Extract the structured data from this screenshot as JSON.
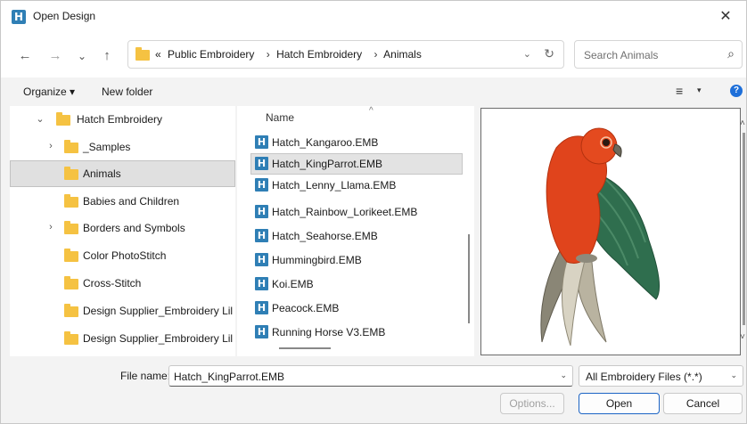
{
  "window": {
    "title": "Open Design",
    "close_symbol": "✕",
    "logo_letter": "H"
  },
  "nav": {
    "back": "←",
    "forward": "→",
    "recent": "⌄",
    "up": "↑",
    "breadcrumb_overflow": "«",
    "breadcrumbs": [
      "Public Embroidery",
      "Hatch Embroidery",
      "Animals"
    ],
    "separator": "›",
    "dropdown": "⌄",
    "refresh": "↻"
  },
  "search": {
    "placeholder": "Search Animals",
    "icon": "⌕"
  },
  "toolbar": {
    "organize_label": "Organize ▾",
    "new_folder_label": "New folder",
    "view_icon": "≡",
    "view_caret": "▾",
    "help": "?"
  },
  "nav_pane": {
    "items": [
      {
        "label": "Hatch Embroidery",
        "chevron": "⌄"
      },
      {
        "label": "_Samples",
        "chevron": "›"
      },
      {
        "label": "Animals",
        "chevron": ""
      },
      {
        "label": "Babies and Children",
        "chevron": ""
      },
      {
        "label": "Borders and Symbols",
        "chevron": "›"
      },
      {
        "label": "Color PhotoStitch",
        "chevron": ""
      },
      {
        "label": "Cross-Stitch",
        "chevron": ""
      },
      {
        "label": "Design Supplier_Embroidery Lil",
        "chevron": ""
      },
      {
        "label": "Design Supplier_Embroidery Lil",
        "chevron": ""
      }
    ]
  },
  "file_pane": {
    "column_name": "Name",
    "sort_indicator": "^",
    "files": [
      "Hatch_Kangaroo.EMB",
      "Hatch_KingParrot.EMB",
      "Hatch_Lenny_Llama.EMB",
      "Hatch_Rainbow_Lorikeet.EMB",
      "Hatch_Seahorse.EMB",
      "Hummingbird.EMB",
      "Koi.EMB",
      "Peacock.EMB",
      "Running Horse V3.EMB"
    ],
    "selected": "Hatch_KingParrot.EMB",
    "file_icon_letter": "H"
  },
  "preview": {
    "scroll_up": "˄",
    "scroll_down": "˅"
  },
  "bottom": {
    "file_name_label": "File name:",
    "file_name_value": "Hatch_KingParrot.EMB",
    "file_type_value": "All Embroidery Files (*.*)",
    "caret": "⌄",
    "options_label": "Options...",
    "open_label": "Open",
    "cancel_label": "Cancel"
  },
  "colors": {
    "accent": "#1c64c4",
    "app_logo": "#2f7fb5",
    "folder": "#f5c242",
    "parrot_red": "#e0441c",
    "parrot_green": "#2f6e4e"
  }
}
